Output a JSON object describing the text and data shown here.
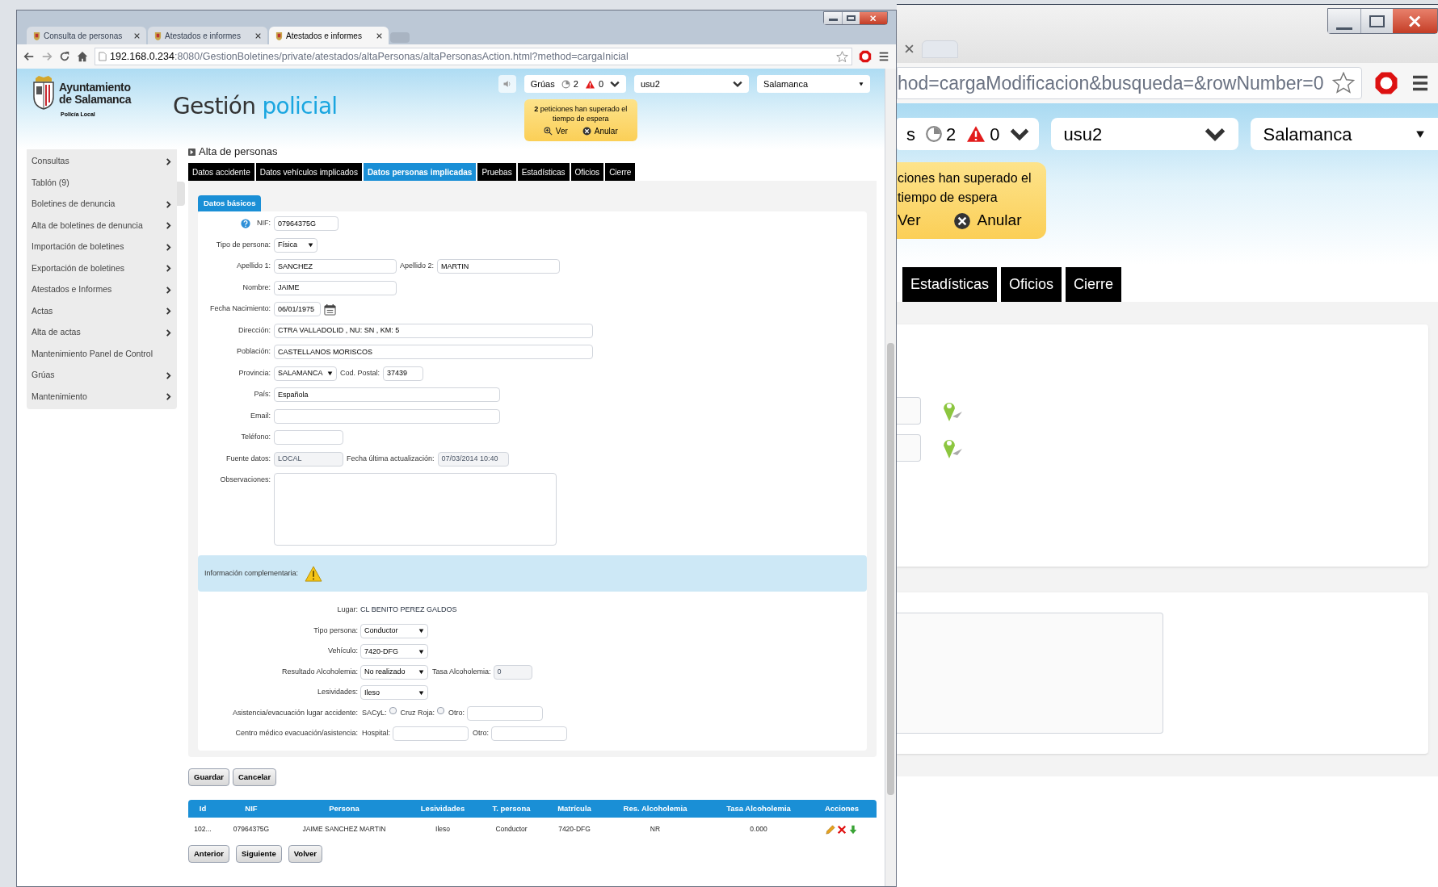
{
  "front_window": {
    "browser_tabs": [
      {
        "title": "Consulta de personas",
        "selected": false
      },
      {
        "title": "Atestados e informes",
        "selected": false
      },
      {
        "title": "Atestados e informes",
        "selected": true
      }
    ],
    "address_bar": {
      "host": "192.168.0.234",
      "path": ":8080/GestionBoletines/private/atestados/altaPersonas/altaPersonasAction.html?method=cargaInicial"
    },
    "header": {
      "logo_lines": [
        "Ayuntamiento",
        "de Salamanca"
      ],
      "logo_subtitle": "Policía Local",
      "app_title": "Gestión",
      "app_title_accent": "policial",
      "gruas": {
        "label": "Grúas",
        "pending": "2",
        "alerts": "0"
      },
      "user": "usu2",
      "city": "Salamanca",
      "notice": {
        "text": "**2** peticiones han superado el tiempo de espera",
        "actions": [
          "Ver",
          "Anular"
        ]
      }
    },
    "sidebar": [
      {
        "label": "Consultas",
        "has_submenu": true
      },
      {
        "label": "Tablón (9)",
        "has_submenu": false
      },
      {
        "label": "Boletines de denuncia",
        "has_submenu": true
      },
      {
        "label": "Alta de boletines de denuncia",
        "has_submenu": true
      },
      {
        "label": "Importación de boletines",
        "has_submenu": true
      },
      {
        "label": "Exportación de boletines",
        "has_submenu": true
      },
      {
        "label": "Atestados e Informes",
        "has_submenu": true
      },
      {
        "label": "Actas",
        "has_submenu": true
      },
      {
        "label": "Alta de actas",
        "has_submenu": true
      },
      {
        "label": "Mantenimiento Panel de Control",
        "has_submenu": false
      },
      {
        "label": "Grúas",
        "has_submenu": true
      },
      {
        "label": "Mantenimiento",
        "has_submenu": true
      }
    ],
    "page_title": "Alta de personas",
    "tabs": [
      {
        "label": "Datos accidente",
        "selected": false
      },
      {
        "label": "Datos vehículos implicados",
        "selected": false
      },
      {
        "label": "Datos personas implicadas",
        "selected": true
      },
      {
        "label": "Pruebas",
        "selected": false
      },
      {
        "label": "Estadísticas",
        "selected": false
      },
      {
        "label": "Oficios",
        "selected": false
      },
      {
        "label": "Cierre",
        "selected": false
      }
    ],
    "section_title": "Datos básicos",
    "basic_rows": [
      [
        {
          "label": "NIF:",
          "kind": "input",
          "value": "07964375G",
          "help": true
        }
      ],
      [
        {
          "label": "Tipo de persona:",
          "kind": "select",
          "value": "Física"
        }
      ],
      [
        {
          "label": "Apellido 1:",
          "kind": "input",
          "value": "SANCHEZ"
        },
        {
          "label": "Apellido 2:",
          "kind": "input",
          "value": "MARTIN"
        }
      ],
      [
        {
          "label": "Nombre:",
          "kind": "input",
          "value": "JAIME"
        }
      ],
      [
        {
          "label": "Fecha Nacimiento:",
          "kind": "date",
          "value": "06/01/1975"
        }
      ],
      [
        {
          "label": "Dirección:",
          "kind": "input",
          "value": "CTRA VALLADOLID , NU: SN , KM: 5"
        }
      ],
      [
        {
          "label": "Población:",
          "kind": "input",
          "value": "CASTELLANOS MORISCOS"
        }
      ],
      [
        {
          "label": "Provincia:",
          "kind": "select",
          "value": "SALAMANCA"
        },
        {
          "label": "Cod. Postal:",
          "kind": "input",
          "value": "37439"
        }
      ],
      [
        {
          "label": "País:",
          "kind": "input",
          "value": "Española"
        }
      ],
      [
        {
          "label": "Email:",
          "kind": "input"
        }
      ],
      [
        {
          "label": "Teléfono:",
          "kind": "input"
        }
      ],
      [
        {
          "label": "Fuente datos:",
          "kind": "readonly",
          "value": "LOCAL"
        },
        {
          "label": "Fecha última actualización:",
          "kind": "readonly",
          "value": "07/03/2014 10:40"
        }
      ],
      [
        {
          "label": "Observaciones:",
          "kind": "textarea"
        }
      ]
    ],
    "complementary": {
      "title": "Información complementaria:",
      "rows": [
        {
          "label": "Lugar:",
          "fields": [
            {
              "kind": "text",
              "value": "CL BENITO PEREZ GALDOS"
            }
          ]
        },
        {
          "label": "Tipo persona:",
          "fields": [
            {
              "kind": "select",
              "value": "Conductor"
            }
          ]
        },
        {
          "label": "Vehículo:",
          "fields": [
            {
              "kind": "select",
              "value": "7420-DFG"
            }
          ]
        },
        {
          "label": "Resultado Alcoholemia:",
          "fields": [
            {
              "kind": "select",
              "value": "No realizado"
            },
            {
              "label": "Tasa Alcoholemia:",
              "kind": "readonly",
              "value": "0"
            }
          ]
        },
        {
          "label": "Lesividades:",
          "fields": [
            {
              "kind": "select",
              "value": "Ileso"
            }
          ]
        },
        {
          "label": "Asistencia/evacuación lugar accidente:",
          "fields": [
            {
              "label": "SACyL:",
              "kind": "checkbox",
              "checked": false
            },
            {
              "label": "Cruz Roja:",
              "kind": "checkbox",
              "checked": false
            },
            {
              "label": "Otro:",
              "kind": "input"
            }
          ]
        },
        {
          "label": "Centro médico evacuación/asistencia:",
          "fields": [
            {
              "label": "Hospital:",
              "kind": "input"
            },
            {
              "label": "Otro:",
              "kind": "input"
            }
          ]
        }
      ]
    },
    "form_buttons": [
      "Guardar",
      "Cancelar"
    ],
    "table": {
      "columns": [
        "Id",
        "NIF",
        "Persona",
        "Lesividades",
        "T. persona",
        "Matrícula",
        "Res. Alcoholemia",
        "Tasa Alcoholemia",
        "Acciones"
      ],
      "rows": [
        [
          "102...",
          "07964375G",
          "JAIME SANCHEZ MARTIN",
          "Ileso",
          "Conductor",
          "7420-DFG",
          "NR",
          "0.000"
        ]
      ]
    },
    "nav_buttons": [
      "Anterior",
      "Siguiente",
      "Volver"
    ]
  },
  "back_window": {
    "address_bar": "hod=cargaModificacion&busqueda=&rowNumber=0",
    "gruas": {
      "label": "s",
      "pending": "2",
      "alerts": "0"
    },
    "user": "usu2",
    "city": "Salamanca",
    "notice": {
      "lines": [
        "ciones han superado el",
        "tiempo de espera"
      ],
      "actions": [
        "Ver",
        "Anular"
      ]
    },
    "tabs": [
      {
        "label": "Estadísticas",
        "selected": false
      },
      {
        "label": "Oficios",
        "selected": false
      },
      {
        "label": "Cierre",
        "selected": false
      }
    ]
  }
}
